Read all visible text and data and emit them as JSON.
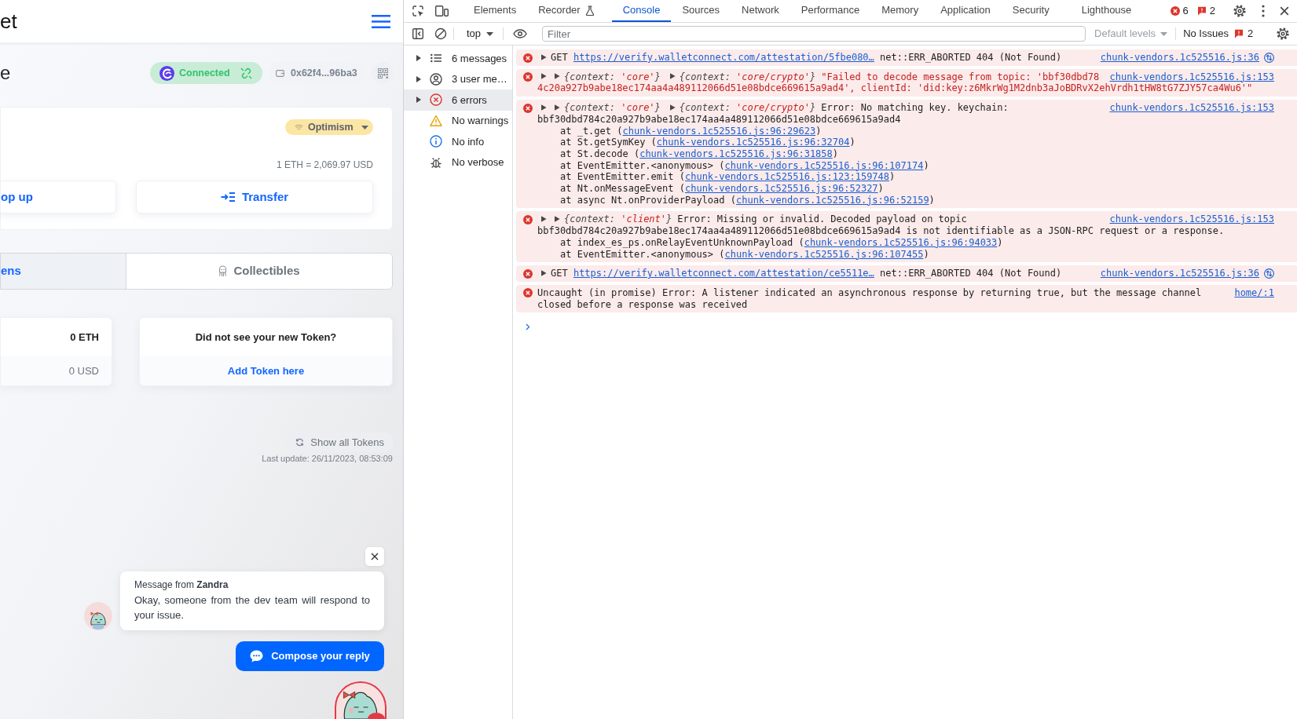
{
  "app": {
    "header": {
      "title": "et"
    },
    "account": {
      "heading": "e",
      "connection": "Connected",
      "address": "0x62f4...96ba3"
    },
    "balance_card": {
      "network": "Optimism",
      "rate": "1 ETH = 2,069.97 USD",
      "actions": [
        {
          "label": "op up",
          "kind": "plain"
        },
        {
          "label": "Transfer",
          "kind": "iconed"
        }
      ]
    },
    "tabs": [
      {
        "label": "ens",
        "selected": true,
        "kind": "plain"
      },
      {
        "label": "Collectibles",
        "selected": false,
        "kind": "iconed"
      }
    ],
    "token": {
      "amount": "0 ETH",
      "value": "0 USD"
    },
    "add_token": {
      "question": "Did not see your new Token?",
      "link": "Add Token here"
    },
    "show_all_button": "Show all Tokens",
    "last_update": "Last update: 26/11/2023, 08:53:09",
    "chat": {
      "sender_line": "Message from **Zandra**",
      "message": "Okay, someone from the dev team will respond to your issue.",
      "reply_button": "Compose your reply"
    }
  },
  "devtools": {
    "panel_tabs": [
      {
        "label": "Elements",
        "selected": false,
        "kind": "panel"
      },
      {
        "label": "Recorder",
        "selected": false,
        "kind": "experiment"
      },
      {
        "label": "Console",
        "selected": true,
        "kind": "panel"
      },
      {
        "label": "Sources",
        "selected": false,
        "kind": "panel"
      },
      {
        "label": "Network",
        "selected": false,
        "kind": "panel"
      },
      {
        "label": "Performance",
        "selected": false,
        "kind": "panel"
      },
      {
        "label": "Memory",
        "selected": false,
        "kind": "panel"
      },
      {
        "label": "Application",
        "selected": false,
        "kind": "panel"
      },
      {
        "label": "Security",
        "selected": false,
        "kind": "panel"
      },
      {
        "label": "Lighthouse",
        "selected": false,
        "kind": "panel"
      }
    ],
    "counters": {
      "errors": "6",
      "issues": "2"
    },
    "console_toolbar": {
      "context": "top",
      "filter": {
        "placeholder": "Filter"
      },
      "levels": {
        "label": "Default levels",
        "disabled": true
      },
      "issues": {
        "label": "No Issues",
        "count": "2"
      }
    },
    "sidebar": [
      {
        "label": "6 messages",
        "kind": "messages",
        "expandable": true,
        "selected": false
      },
      {
        "label": "3 user me…",
        "kind": "user",
        "expandable": true,
        "selected": false
      },
      {
        "label": "6 errors",
        "kind": "errors",
        "expandable": true,
        "selected": true
      },
      {
        "label": "No warnings",
        "kind": "warnings",
        "expandable": false,
        "selected": false
      },
      {
        "label": "No info",
        "kind": "info",
        "expandable": false,
        "selected": false
      },
      {
        "label": "No verbose",
        "kind": "verbose",
        "expandable": false,
        "selected": false
      }
    ],
    "messages": [
      {
        "kind": "network",
        "source": "chunk-vendors.1c525516.js:36",
        "lines": [
          [
            {
              "kind": "toggle"
            },
            {
              "kind": "request",
              "text": "GET ",
              "link": "https://verify.walletconnect.com/attestation/5fbe080…",
              "end": " net::ERR_ABORTED 404 (Not Found)"
            }
          ]
        ]
      },
      {
        "kind": "error",
        "source": "chunk-vendors.1c525516.js:153",
        "lines": [
          [
            {
              "kind": "toggle"
            },
            {
              "kind": "toggle"
            },
            {
              "kind": "object",
              "open": "{context: ",
              "value": "'core'",
              "close": "}"
            },
            {
              "kind": "toggle"
            },
            {
              "kind": "object",
              "open": "{context: ",
              "value": "'core/crypto'",
              "close": "}"
            },
            {
              "kind": "string",
              "text": "\"Failed to decode message from topic: 'bbf30dbd78"
            }
          ],
          [
            {
              "kind": "string",
              "text": "4c20a927b9abe18ec174aa4a489112066d51e08bdce669615a9ad4', clientId: 'did:key:z6MkrWg1M2dnb3aJoBDRvX2ehVrdh1tHW8tG7ZJY57ca4Wu6'\""
            }
          ]
        ]
      },
      {
        "kind": "error",
        "source": "chunk-vendors.1c525516.js:153",
        "lines": [
          [
            {
              "kind": "toggle"
            },
            {
              "kind": "toggle"
            },
            {
              "kind": "object",
              "open": "{context: ",
              "value": "'core'",
              "close": "}"
            },
            {
              "kind": "toggle"
            },
            {
              "kind": "object",
              "open": "{context: ",
              "value": "'core/crypto'",
              "close": "}"
            },
            {
              "kind": "text",
              "text": "Error: No matching key. keychain:"
            }
          ],
          [
            {
              "kind": "text",
              "text": "bbf30dbd784c20a927b9abe18ec174aa4a489112066d51e08bdce669615a9ad4"
            }
          ],
          [
            {
              "kind": "frame",
              "text": "at _t.get (",
              "link": "chunk-vendors.1c525516.js:96:29623",
              "end": ")"
            }
          ],
          [
            {
              "kind": "frame",
              "text": "at St.getSymKey (",
              "link": "chunk-vendors.1c525516.js:96:32704",
              "end": ")"
            }
          ],
          [
            {
              "kind": "frame",
              "text": "at St.decode (",
              "link": "chunk-vendors.1c525516.js:96:31858",
              "end": ")"
            }
          ],
          [
            {
              "kind": "frame",
              "text": "at EventEmitter.<anonymous> (",
              "link": "chunk-vendors.1c525516.js:96:107174",
              "end": ")"
            }
          ],
          [
            {
              "kind": "frame",
              "text": "at EventEmitter.emit (",
              "link": "chunk-vendors.1c525516.js:123:159748",
              "end": ")"
            }
          ],
          [
            {
              "kind": "frame",
              "text": "at Nt.onMessageEvent (",
              "link": "chunk-vendors.1c525516.js:96:52327",
              "end": ")"
            }
          ],
          [
            {
              "kind": "frame",
              "text": "at async Nt.onProviderPayload (",
              "link": "chunk-vendors.1c525516.js:96:52159",
              "end": ")"
            }
          ]
        ]
      },
      {
        "kind": "error",
        "source": "chunk-vendors.1c525516.js:153",
        "lines": [
          [
            {
              "kind": "toggle"
            },
            {
              "kind": "toggle"
            },
            {
              "kind": "object",
              "open": "{context: ",
              "value": "'client'",
              "close": "}"
            },
            {
              "kind": "text",
              "text": "Error: Missing or invalid. Decoded payload on topic"
            }
          ],
          [
            {
              "kind": "text",
              "text": "bbf30dbd784c20a927b9abe18ec174aa4a489112066d51e08bdce669615a9ad4 is not identifiable as a JSON-RPC request or a response."
            }
          ],
          [
            {
              "kind": "frame",
              "text": "at index_es_ps.onRelayEventUnknownPayload (",
              "link": "chunk-vendors.1c525516.js:96:94033",
              "end": ")"
            }
          ],
          [
            {
              "kind": "frame",
              "text": "at EventEmitter.<anonymous> (",
              "link": "chunk-vendors.1c525516.js:96:107455",
              "end": ")"
            }
          ]
        ]
      },
      {
        "kind": "network",
        "source": "chunk-vendors.1c525516.js:36",
        "lines": [
          [
            {
              "kind": "toggle"
            },
            {
              "kind": "request",
              "text": "GET ",
              "link": "https://verify.walletconnect.com/attestation/ce5511e…",
              "end": " net::ERR_ABORTED 404 (Not Found)"
            }
          ]
        ]
      },
      {
        "kind": "error",
        "source": "home/:1",
        "lines": [
          [
            {
              "kind": "text",
              "text": "Uncaught (in promise) Error: A listener indicated an asynchronous response by returning true, but the message channel closed before a response was received"
            }
          ]
        ]
      }
    ]
  }
}
